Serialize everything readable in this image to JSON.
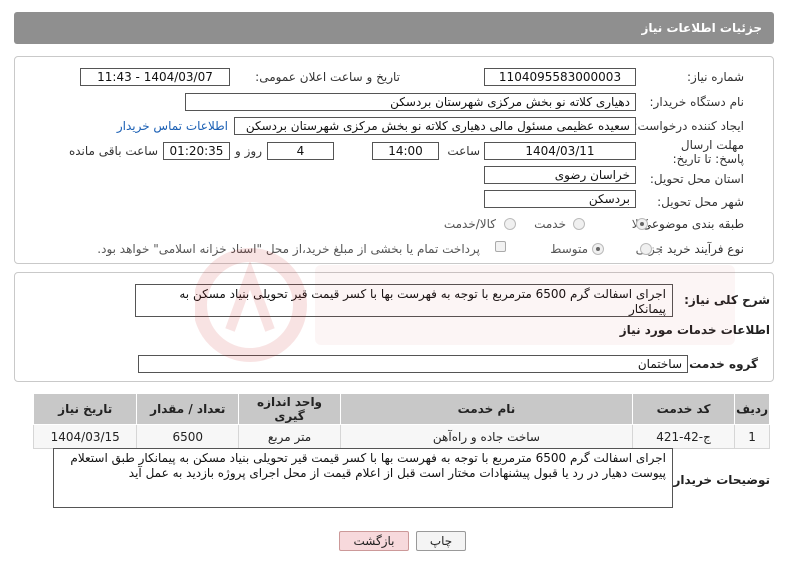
{
  "header": {
    "title": "جزئیات اطلاعات نیاز"
  },
  "fields": {
    "need_number_label": "شماره نیاز:",
    "need_number": "1104095583000003",
    "announce_label": "تاریخ و ساعت اعلان عمومی:",
    "announce_value": "1404/03/07 - 11:43",
    "buyer_org_label": "نام دستگاه خریدار:",
    "buyer_org": "دهیاری کلاته نو بخش مرکزی شهرستان بردسکن",
    "creator_label": "ایجاد کننده درخواست:",
    "creator": "سعیده عظیمی مسئول مالی دهیاری کلاته نو بخش مرکزی شهرستان بردسکن",
    "contact_link": "اطلاعات تماس خریدار",
    "deadline_label": "مهلت ارسال پاسخ: تا تاریخ:",
    "deadline_date": "1404/03/11",
    "time_label": "ساعت",
    "deadline_time": "14:00",
    "days_value": "4",
    "days_label": "روز و",
    "remaining_time": "01:20:35",
    "remaining_label": "ساعت باقی مانده",
    "province_label": "استان محل تحویل:",
    "province": "خراسان رضوی",
    "city_label": "شهر محل تحویل:",
    "city": "بردسکن",
    "category_label": "طبقه بندی موضوعی:",
    "category_options": [
      "کالا",
      "خدمت",
      "کالا/خدمت"
    ],
    "process_label": "نوع فرآیند خرید :",
    "process_options": [
      "جزیی",
      "متوسط"
    ],
    "payment_note": "پرداخت تمام یا بخشی از مبلغ خرید،از محل \"اسناد خزانه اسلامی\" خواهد بود."
  },
  "summary": {
    "label": "شرح کلی نیاز:",
    "text": "اجرای اسفالت گرم 6500 مترمربع با توجه به فهرست بها با کسر قیمت قیر تحویلی بنیاد مسکن به پیمانکار"
  },
  "services": {
    "section_title": "اطلاعات خدمات مورد نیاز",
    "group_label": "گروه خدمت:",
    "group_value": "ساختمان",
    "columns": [
      "ردیف",
      "کد خدمت",
      "نام خدمت",
      "واحد اندازه گیری",
      "تعداد / مقدار",
      "تاریخ نیاز"
    ],
    "rows": [
      [
        "1",
        "ج-42-421",
        "ساخت جاده و راه‌آهن",
        "متر مربع",
        "6500",
        "1404/03/15"
      ]
    ]
  },
  "buyer_notes": {
    "label": "توضیحات خریدار:",
    "text": "اجرای اسفالت گرم 6500 مترمربع با توجه به فهرست بها با کسر قیمت قیر تحویلی بنیاد مسکن به پیمانکار طبق استعلام پیوست دهیار در رد یا قبول پیشنهادات مختار است قبل از اعلام قیمت از محل اجرای پروژه بازدید به عمل آید"
  },
  "buttons": {
    "print": "چاپ",
    "back": "بازگشت"
  },
  "colors": {
    "header": "#8f8f8f",
    "link": "#1a5fb4",
    "back_button": "#f7d9dc",
    "table_header": "#c8c8c8"
  }
}
